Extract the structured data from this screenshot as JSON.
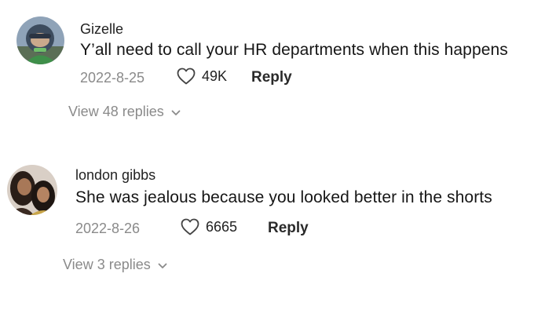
{
  "comments": [
    {
      "author": "Gizelle",
      "text": "Y’all need to call your HR departments when this happens",
      "date": "2022-8-25",
      "likes": "49K",
      "reply_label": "Reply",
      "view_replies": "View 48 replies",
      "avatar_icon": "profile-photo"
    },
    {
      "author": "london gibbs",
      "text": "She was jealous because you looked better in the shorts",
      "date": "2022-8-26",
      "likes": "6665",
      "reply_label": "Reply",
      "view_replies": "View 3 replies",
      "avatar_icon": "profile-photo"
    }
  ],
  "colors": {
    "primary_text": "#161616",
    "secondary_text": "#8a8a8a",
    "background": "#ffffff"
  }
}
